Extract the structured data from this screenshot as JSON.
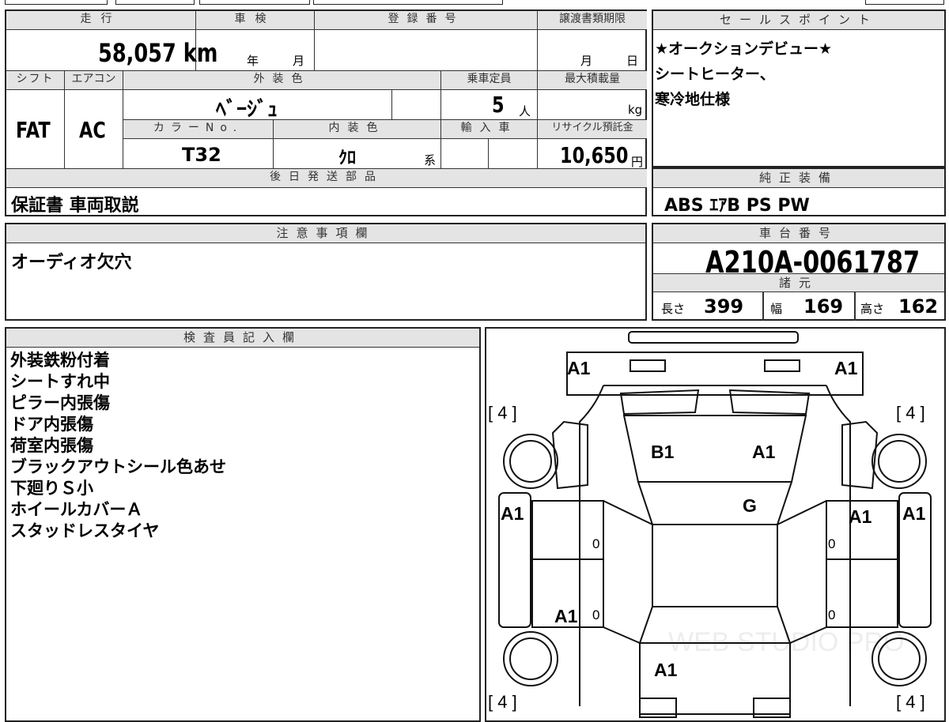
{
  "top_strip": [
    "",
    "",
    "",
    "",
    ""
  ],
  "mileage": {
    "label": "走行",
    "value": "58,057 km"
  },
  "inspection": {
    "label": "車検",
    "year_unit": "年",
    "month_unit": "月"
  },
  "registration": {
    "label": "登録番号",
    "value": ""
  },
  "transfer_deadline": {
    "label": "譲渡書類期限",
    "month_unit": "月",
    "day_unit": "日"
  },
  "shift": {
    "label": "シフト",
    "value": "FAT"
  },
  "aircon": {
    "label": "エアコン",
    "value": "AC"
  },
  "exterior_color": {
    "label": "外装色",
    "value": "ﾍﾞｰｼﾞｭ"
  },
  "capacity": {
    "label": "乗車定員",
    "value": "5",
    "unit": "人"
  },
  "max_load": {
    "label": "最大積載量",
    "unit": "kg"
  },
  "color_no": {
    "label": "カラーNo.",
    "value": "T32"
  },
  "interior_color": {
    "label": "内装色",
    "value": "ｸﾛ",
    "unit": "系"
  },
  "import": {
    "label": "輸入車"
  },
  "recycle_fee": {
    "label": "リサイクル預託金",
    "value": "10,650",
    "unit": "円"
  },
  "later_parts": {
    "label": "後日発送部品",
    "value": "保証書 車両取説"
  },
  "sales_points": {
    "label": "セールスポイント",
    "lines": [
      "★オークションデビュー★",
      "シートヒーター、",
      "寒冷地仕様"
    ]
  },
  "genuine_equipment": {
    "label": "純正装備",
    "value": "ABS ｴｱB PS PW"
  },
  "notes": {
    "label": "注意事項欄",
    "value": "オーディオ欠穴"
  },
  "chassis_number": {
    "label": "車台番号",
    "value": "A210A-0061787"
  },
  "specs": {
    "label": "諸元",
    "length_label": "長さ",
    "length": "399",
    "width_label": "幅",
    "width": "169",
    "height_label": "高さ",
    "height": "162"
  },
  "inspector": {
    "label": "検査員記入欄",
    "lines": [
      "外装鉄粉付着",
      "シートすれ中",
      "ピラー内張傷",
      "ドア内張傷",
      "荷室内張傷",
      "ブラックアウトシール色あせ",
      "下廻りＳ小",
      "ホイールカバーＡ",
      "スタッドレスタイヤ"
    ]
  },
  "diagram": {
    "marks": [
      "A1",
      "A1",
      "B1",
      "A1",
      "G",
      "A1",
      "A1",
      "A1",
      "A1",
      "A1",
      "A1"
    ],
    "tire_tl": "[ 4 ]",
    "tire_tr": "[ 4 ]",
    "tire_bl": "[ 4 ]",
    "tire_br": "[ 4 ]",
    "zero_marks": [
      "0",
      "0",
      "0",
      "0"
    ],
    "watermark": "WEB STUDIO PRO"
  }
}
